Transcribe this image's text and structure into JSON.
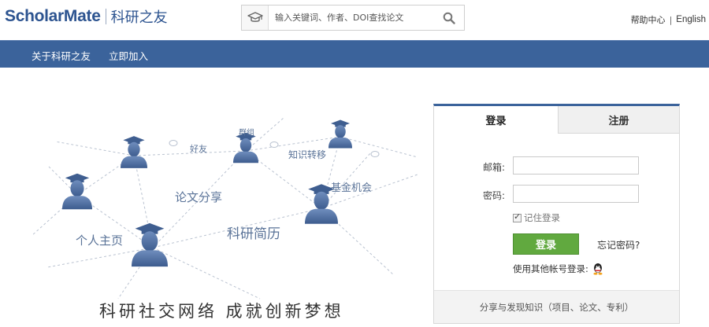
{
  "header": {
    "logo_en": "ScholarMate",
    "logo_cn": "科研之友",
    "search": {
      "placeholder": "输入关键词、作者、DOI查找论文"
    },
    "help_label": "帮助中心",
    "lang_label": "English"
  },
  "nav": {
    "items": [
      {
        "label": "关于科研之友"
      },
      {
        "label": "立即加入"
      }
    ]
  },
  "hero": {
    "labels": {
      "friends": "好友",
      "groups": "群组",
      "knowledge": "知识转移",
      "papers": "论文分享",
      "funding": "基金机会",
      "homepage": "个人主页",
      "cv": "科研简历"
    },
    "slogan": "科研社交网络   成就创新梦想"
  },
  "login": {
    "tabs": [
      {
        "label": "登录",
        "active": true
      },
      {
        "label": "注册",
        "active": false
      }
    ],
    "email_label": "邮箱:",
    "password_label": "密码:",
    "remember_label": "记住登录",
    "remember_checked": true,
    "login_button": "登录",
    "forgot_link": "忘记密码?",
    "other_login_label": "使用其他帐号登录:",
    "footer": "分享与发现知识（项目、论文、专利）"
  },
  "colors": {
    "brand_blue": "#3b639b",
    "login_green": "#61a93f",
    "icon_blue": "#4d6c9e"
  }
}
